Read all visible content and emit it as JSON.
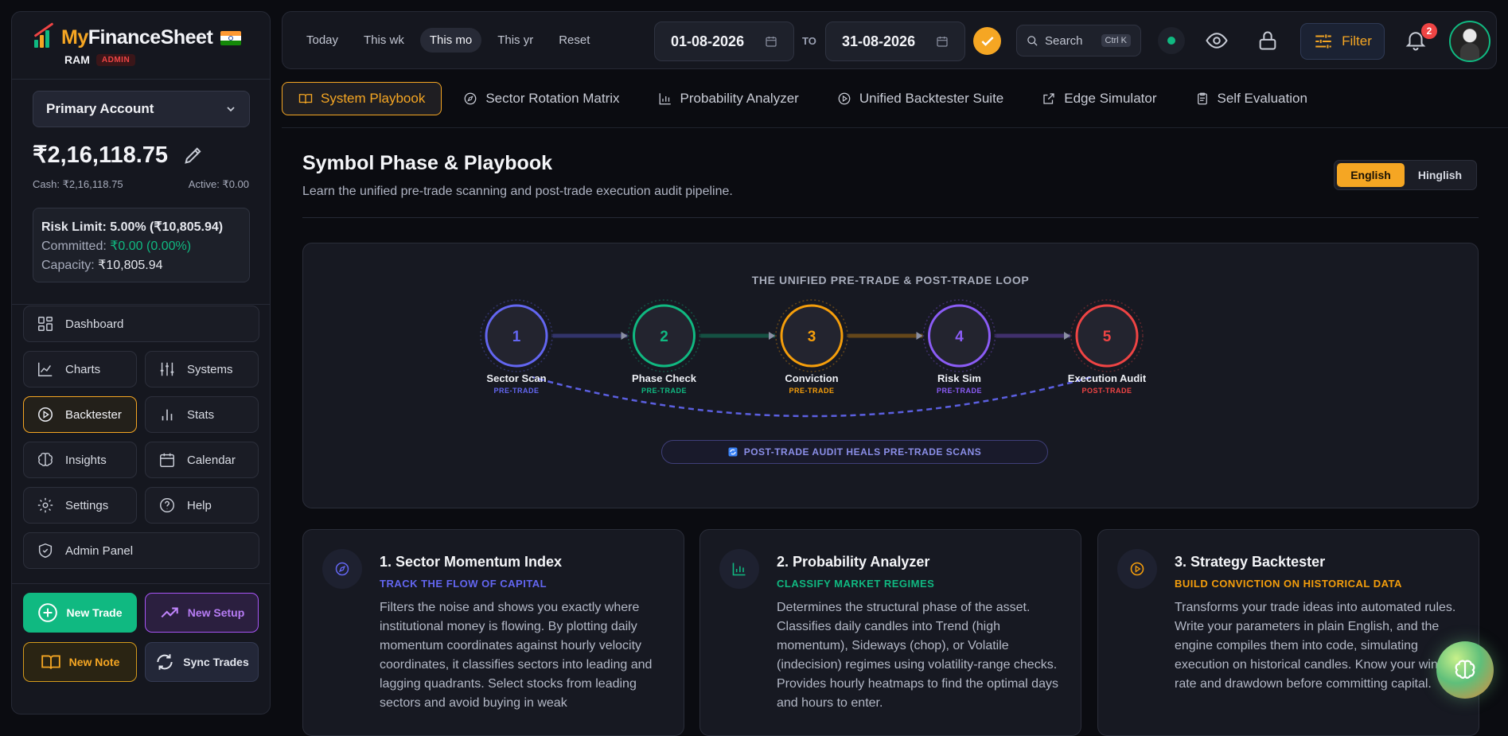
{
  "brand": {
    "name_part1": "My",
    "name_part2": "FinanceSheet",
    "user": "RAM",
    "role_badge": "ADMIN"
  },
  "account": {
    "selected": "Primary Account",
    "balance": "₹2,16,118.75",
    "cash": "Cash: ₹2,16,118.75",
    "active": "Active: ₹0.00",
    "risk_limit": "Risk Limit: 5.00% (₹10,805.94)",
    "committed_label": "Committed: ",
    "committed_value": "₹0.00 (0.00%)",
    "capacity_label": "Capacity: ",
    "capacity_value": "₹10,805.94"
  },
  "nav": {
    "dashboard": "Dashboard",
    "charts": "Charts",
    "systems": "Systems",
    "backtester": "Backtester",
    "stats": "Stats",
    "insights": "Insights",
    "calendar": "Calendar",
    "settings": "Settings",
    "help": "Help",
    "admin_panel": "Admin Panel"
  },
  "actions": {
    "new_trade": "New Trade",
    "new_setup": "New Setup",
    "new_note": "New Note",
    "sync_trades": "Sync Trades"
  },
  "topbar": {
    "ranges": [
      "Today",
      "This wk",
      "This mo",
      "This yr",
      "Reset"
    ],
    "selected_range": "This mo",
    "date_from": "01-08-2026",
    "to_label": "TO",
    "date_to": "31-08-2026",
    "search_placeholder": "Search",
    "search_shortcut": "Ctrl K",
    "filter_label": "Filter",
    "notification_count": "2"
  },
  "tabs": [
    "System Playbook",
    "Sector Rotation Matrix",
    "Probability Analyzer",
    "Unified Backtester Suite",
    "Edge Simulator",
    "Self Evaluation"
  ],
  "page": {
    "title": "Symbol Phase & Playbook",
    "subtitle": "Learn the unified pre-trade scanning and post-trade execution audit pipeline.",
    "lang_english": "English",
    "lang_hinglish": "Hinglish"
  },
  "loop": {
    "title": "THE UNIFIED PRE-TRADE & POST-TRADE LOOP",
    "steps": [
      {
        "num": "1",
        "label": "Sector Scan",
        "tag": "PRE-TRADE",
        "color": "#6366f1"
      },
      {
        "num": "2",
        "label": "Phase Check",
        "tag": "PRE-TRADE",
        "color": "#10b981"
      },
      {
        "num": "3",
        "label": "Conviction",
        "tag": "PRE-TRADE",
        "color": "#f59e0b"
      },
      {
        "num": "4",
        "label": "Risk Sim",
        "tag": "PRE-TRADE",
        "color": "#8b5cf6"
      },
      {
        "num": "5",
        "label": "Execution Audit",
        "tag": "POST-TRADE",
        "color": "#ef4444"
      }
    ],
    "heal_text": "POST-TRADE AUDIT HEALS PRE-TRADE SCANS"
  },
  "cards": [
    {
      "title": "1. Sector Momentum Index",
      "subtitle": "TRACK THE FLOW OF CAPITAL",
      "color": "#6366f1",
      "body": "Filters the noise and shows you exactly where institutional money is flowing. By plotting daily momentum coordinates against hourly velocity coordinates, it classifies sectors into leading and lagging quadrants. Select stocks from leading sectors and avoid buying in weak"
    },
    {
      "title": "2. Probability Analyzer",
      "subtitle": "CLASSIFY MARKET REGIMES",
      "color": "#10b981",
      "body": "Determines the structural phase of the asset. Classifies daily candles into Trend (high momentum), Sideways (chop), or Volatile (indecision) regimes using volatility-range checks. Provides hourly heatmaps to find the optimal days and hours to enter."
    },
    {
      "title": "3. Strategy Backtester",
      "subtitle": "BUILD CONVICTION ON HISTORICAL DATA",
      "color": "#f59e0b",
      "body": "Transforms your trade ideas into automated rules. Write your parameters in plain English, and the engine compiles them into code, simulating execution on historical candles. Know your win rate and drawdown before committing capital."
    }
  ]
}
